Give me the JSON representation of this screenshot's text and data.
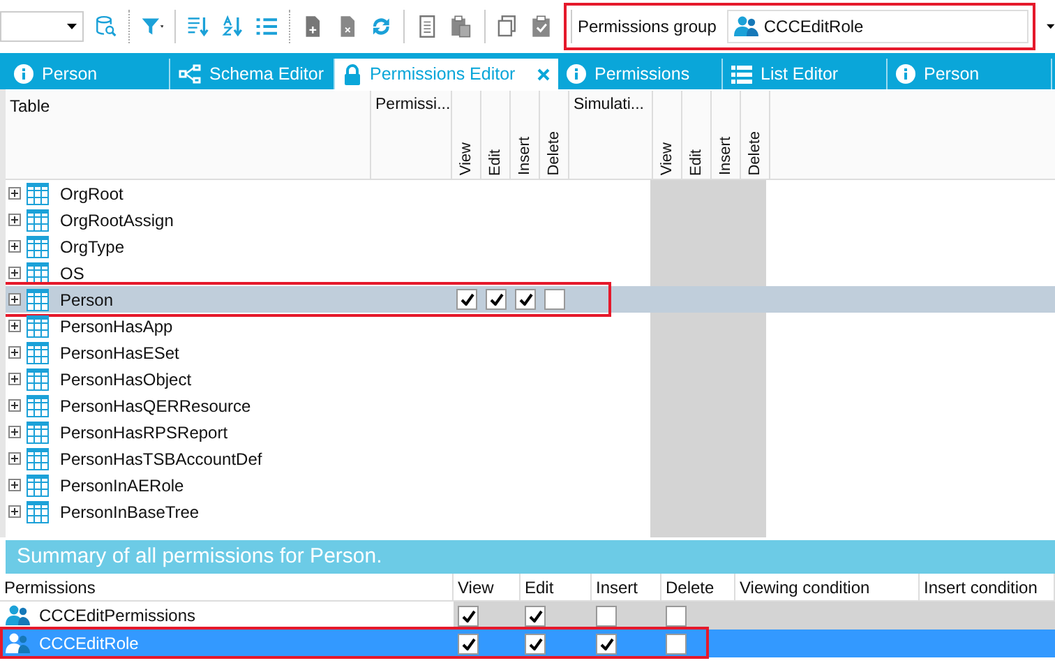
{
  "toolbar": {
    "permissions_group": {
      "label": "Permissions group",
      "value": "CCCEditRole"
    }
  },
  "tabs": [
    {
      "label": "Person",
      "kind": "info",
      "selected": false,
      "closable": false
    },
    {
      "label": "Schema Editor",
      "kind": "schema",
      "selected": false,
      "closable": false
    },
    {
      "label": "Permissions Editor",
      "kind": "lock",
      "selected": true,
      "closable": true
    },
    {
      "label": "Permissions",
      "kind": "info",
      "selected": false,
      "closable": false
    },
    {
      "label": "List Editor",
      "kind": "list",
      "selected": false,
      "closable": false
    },
    {
      "label": "Person",
      "kind": "info",
      "selected": false,
      "closable": false
    }
  ],
  "table": {
    "columns": {
      "table": "Table",
      "permissions": "Permissi...",
      "simulation": "Simulati...",
      "rights": [
        "View",
        "Edit",
        "Insert",
        "Delete"
      ],
      "sim_rights": [
        "View",
        "Edit",
        "Insert",
        "Delete"
      ]
    },
    "rows": [
      {
        "name": "OrgRoot",
        "selected": false
      },
      {
        "name": "OrgRootAssign",
        "selected": false
      },
      {
        "name": "OrgType",
        "selected": false
      },
      {
        "name": "OS",
        "selected": false
      },
      {
        "name": "Person",
        "selected": true,
        "highlighted": true,
        "rights": [
          true,
          true,
          true,
          false
        ]
      },
      {
        "name": "PersonHasApp",
        "selected": false
      },
      {
        "name": "PersonHasESet",
        "selected": false
      },
      {
        "name": "PersonHasObject",
        "selected": false
      },
      {
        "name": "PersonHasQERResource",
        "selected": false
      },
      {
        "name": "PersonHasRPSReport",
        "selected": false
      },
      {
        "name": "PersonHasTSBAccountDef",
        "selected": false
      },
      {
        "name": "PersonInAERole",
        "selected": false
      },
      {
        "name": "PersonInBaseTree",
        "selected": false
      }
    ]
  },
  "summary": {
    "title": "Summary of all permissions for Person.",
    "columns": [
      "Permissions",
      "View",
      "Edit",
      "Insert",
      "Delete",
      "Viewing condition",
      "Insert condition"
    ],
    "rows": [
      {
        "name": "CCCEditPermissions",
        "selected": false,
        "highlighted": false,
        "rights": [
          true,
          true,
          false,
          false
        ]
      },
      {
        "name": "CCCEditRole",
        "selected": true,
        "highlighted": true,
        "rights": [
          true,
          true,
          true,
          false
        ]
      }
    ]
  }
}
